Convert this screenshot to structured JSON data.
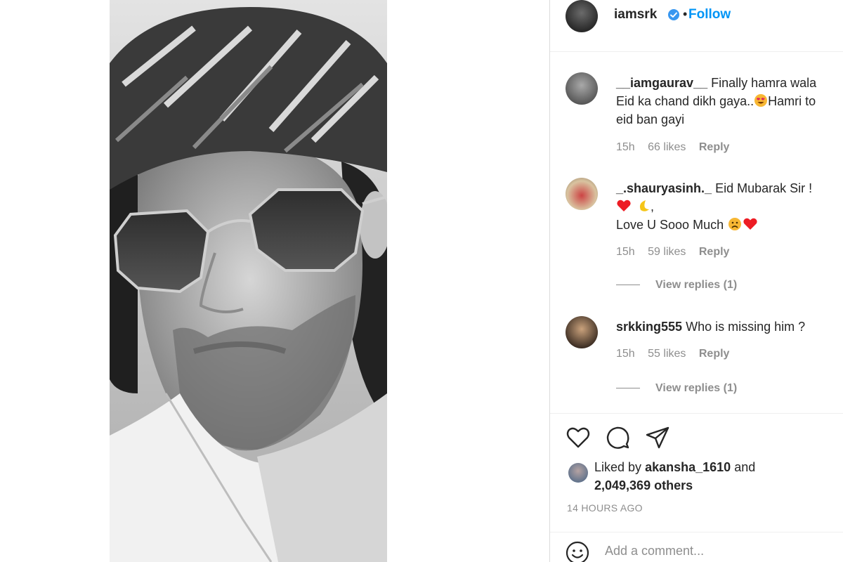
{
  "post": {
    "username": "iamsrk",
    "follow_label": "Follow",
    "separator": "•"
  },
  "comments": [
    {
      "username": "__iamgaurav__",
      "text_before_emoji": "Finally hamra wala Eid ka chand dikh gaya..",
      "emoji": "heart-eyes-emoji",
      "text_after_emoji": "Hamri to eid ban gayi",
      "time": "15h",
      "likes": "66 likes",
      "reply": "Reply"
    },
    {
      "username": "_.shauryasinh._",
      "text": "Eid Mubarak Sir !",
      "emojis": [
        "heart-emoji",
        "crescent-moon-emoji"
      ],
      "trailing": ",",
      "text2": "Love U Sooo Much",
      "emojis2": [
        "sad-face-emoji",
        "heart-emoji"
      ],
      "time": "15h",
      "likes": "59 likes",
      "reply": "Reply",
      "view_replies": "View replies (1)"
    },
    {
      "username": "srkking555",
      "text": "Who is missing him ?",
      "time": "15h",
      "likes": "55 likes",
      "reply": "Reply",
      "view_replies": "View replies (1)"
    }
  ],
  "actions": [
    "heart-icon",
    "comment-icon",
    "share-icon"
  ],
  "likes": {
    "prefix": "Liked by",
    "user": "akansha_1610",
    "connector": "and",
    "others": "2,049,369 others"
  },
  "timestamp": "14 HOURS AGO",
  "add_comment": {
    "placeholder": "Add a comment..."
  },
  "colors": {
    "follow": "#0095f6",
    "verified": "#3897f0",
    "heart": "#ed1c24",
    "muted": "#8e8e8e"
  }
}
